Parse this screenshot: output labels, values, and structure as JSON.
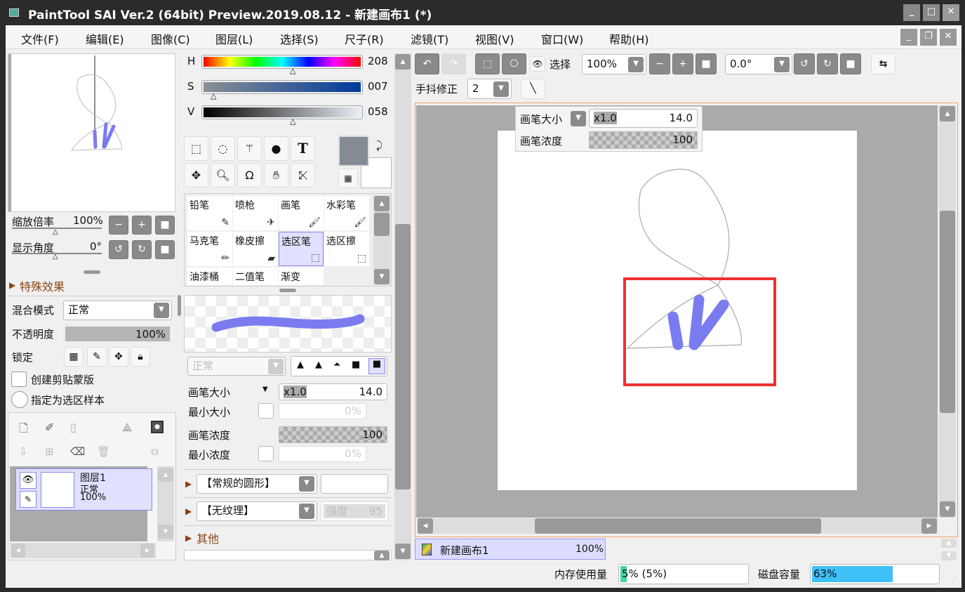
{
  "window": {
    "title": "PaintTool SAI Ver.2 (64bit) Preview.2019.08.12 - 新建画布1 (*)",
    "min": "_",
    "max": "□",
    "close": "✕"
  },
  "menu": [
    "文件(F)",
    "编辑(E)",
    "图像(C)",
    "图层(L)",
    "选择(S)",
    "尺子(R)",
    "滤镜(T)",
    "视图(V)",
    "窗口(W)",
    "帮助(H)"
  ],
  "navigator": {
    "zoom_label": "缩放倍率",
    "zoom_value": "100%",
    "angle_label": "显示角度",
    "angle_value": "0°"
  },
  "layer_props": {
    "effects": "特殊效果",
    "blend_label": "混合模式",
    "blend_value": "正常",
    "opacity_label": "不透明度",
    "opacity_value": "100%",
    "opacity_percent": 100,
    "lock_label": "锁定",
    "clip_label": "创建剪贴蒙版",
    "sample_label": "指定为选区样本"
  },
  "layers": [
    {
      "name": "图层1",
      "mode": "正常",
      "opacity": "100%"
    }
  ],
  "color": {
    "h_label": "H",
    "h_value": "208",
    "s_label": "S",
    "s_value": "007",
    "v_label": "V",
    "v_value": "058",
    "primary": "#858b93",
    "secondary": "#ffffff"
  },
  "brushes": [
    "铅笔",
    "喷枪",
    "画笔",
    "水彩笔",
    "马克笔",
    "橡皮擦",
    "选区笔",
    "选区擦",
    "油漆桶",
    "二值笔",
    "渐变"
  ],
  "selected_brush": "选区笔",
  "brush_settings": {
    "mode": "正常",
    "size_label": "画笔大小",
    "size_mult": "x1.0",
    "size_value": "14.0",
    "min_size_label": "最小大小",
    "min_size_value": "0%",
    "density_label": "画笔浓度",
    "density_value": "100",
    "min_density_label": "最小浓度",
    "min_density_value": "0%",
    "shape": "【常规的圆形】",
    "texture": "【无纹理】",
    "strength_label": "强度",
    "strength_value": "95",
    "other": "其他"
  },
  "toolbar": {
    "select_label": "选择",
    "zoom": "100%",
    "angle": "0.0°",
    "stabilizer_label": "手抖修正",
    "stabilizer_value": "2"
  },
  "overlay": {
    "size_label": "画笔大小",
    "size_mult": "x1.0",
    "size_value": "14.0",
    "density_label": "画笔浓度",
    "density_value": "100"
  },
  "canvas_tab": {
    "name": "新建画布1",
    "zoom": "100%"
  },
  "status": {
    "memory_label": "内存使用量",
    "memory_value": "5% (5%)",
    "memory_percent": 5,
    "disk_label": "磁盘容量",
    "disk_value": "63%",
    "disk_percent": 63
  }
}
